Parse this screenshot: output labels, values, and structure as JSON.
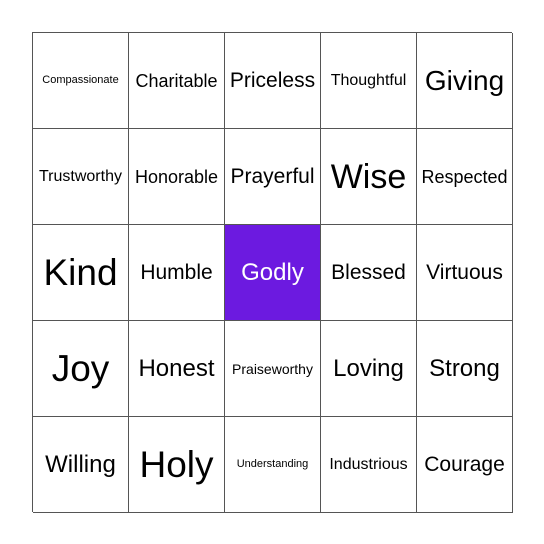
{
  "board": {
    "free_color": "#6c1ae0",
    "cells": [
      [
        "Compassionate",
        "Charitable",
        "Priceless",
        "Thoughtful",
        "Giving"
      ],
      [
        "Trustworthy",
        "Honorable",
        "Prayerful",
        "Wise",
        "Respected"
      ],
      [
        "Kind",
        "Humble",
        "Godly",
        "Blessed",
        "Virtuous"
      ],
      [
        "Joy",
        "Honest",
        "Praiseworthy",
        "Loving",
        "Strong"
      ],
      [
        "Willing",
        "Holy",
        "Understanding",
        "Industrious",
        "Courage"
      ]
    ]
  }
}
